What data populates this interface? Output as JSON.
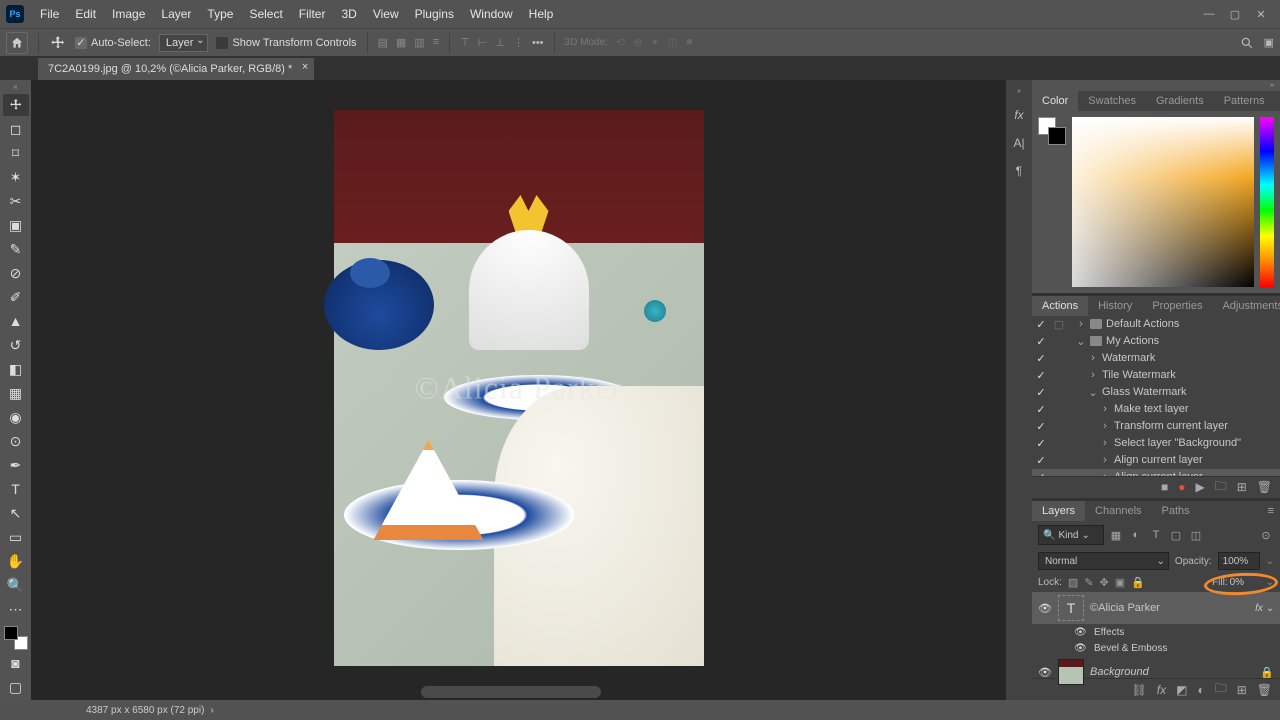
{
  "menu": [
    "File",
    "Edit",
    "Image",
    "Layer",
    "Type",
    "Select",
    "Filter",
    "3D",
    "View",
    "Plugins",
    "Window",
    "Help"
  ],
  "optionsbar": {
    "auto_select_label": "Auto-Select:",
    "auto_select_target": "Layer",
    "show_transform_label": "Show Transform Controls",
    "mode3d_label": "3D Mode:"
  },
  "doc_tab": {
    "title": "7C2A0199.jpg @ 10,2% (©Alicia Parker, RGB/8) *"
  },
  "watermark_text": "©Alicia Parker",
  "color_panel_tabs": [
    "Color",
    "Swatches",
    "Gradients",
    "Patterns"
  ],
  "actions_panel_tabs": [
    "Actions",
    "History",
    "Properties",
    "Adjustments"
  ],
  "actions": {
    "root": "Default Actions",
    "set": "My Actions",
    "items": [
      "Watermark",
      "Tile Watermark"
    ],
    "open_action": "Glass Watermark",
    "steps": [
      "Make text layer",
      "Transform current layer",
      "Select layer \"Background\"",
      "Align current layer",
      "Align current layer"
    ]
  },
  "layers_panel_tabs": [
    "Layers",
    "Channels",
    "Paths"
  ],
  "layers": {
    "kind_label": "Kind",
    "blend_mode": "Normal",
    "opacity_label": "Opacity:",
    "opacity_value": "100%",
    "lock_label": "Lock:",
    "fill_label": "Fill:",
    "fill_value": "0%",
    "layer1": "©Alicia Parker",
    "effects_label": "Effects",
    "bevel_label": "Bevel & Emboss",
    "bg_label": "Background"
  },
  "statusbar": {
    "dims": "4387 px x 6580 px (72 ppi)"
  }
}
